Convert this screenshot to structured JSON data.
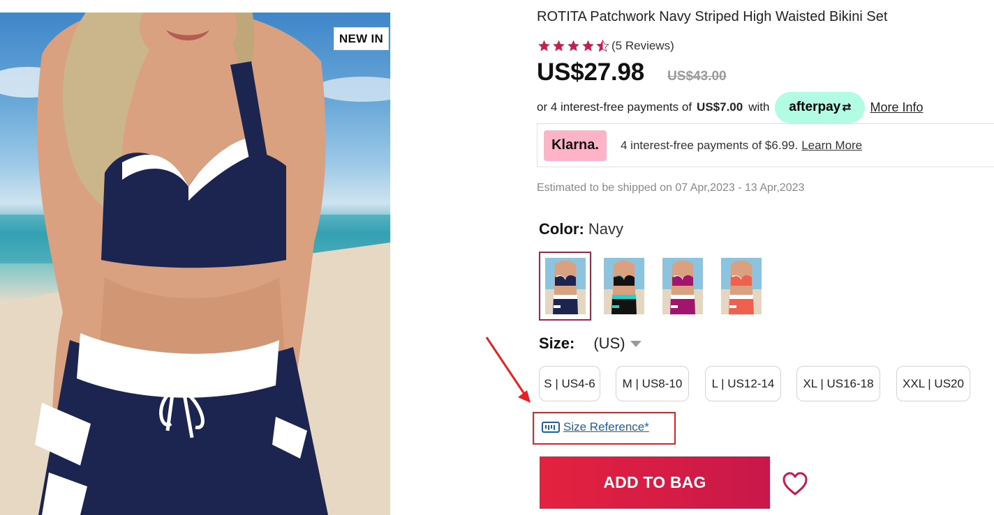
{
  "product": {
    "badge": "NEW IN",
    "title": "ROTITA Patchwork Navy Striped High Waisted Bikini Set",
    "rating": 4.5,
    "reviews": "(5 Reviews)",
    "price": "US$27.98",
    "old_price": "US$43.00"
  },
  "afterpay": {
    "prefix": "or 4 interest-free payments of",
    "amount": "US$7.00",
    "with": "with",
    "brand": "afterpay",
    "more_info": "More Info"
  },
  "klarna": {
    "brand": "Klarna.",
    "text": "4 interest-free payments of $6.99.",
    "learn_more": "Learn More"
  },
  "shipping": "Estimated to be shipped on 07 Apr,2023 - 13 Apr,2023",
  "color": {
    "label": "Color:",
    "value": "Navy",
    "swatches": [
      {
        "name": "navy",
        "top": "#1c2450",
        "accent": "#ffffff",
        "selected": true
      },
      {
        "name": "aqua",
        "top": "#121212",
        "accent": "#2ad1c4",
        "selected": false
      },
      {
        "name": "magenta",
        "top": "#a2146e",
        "accent": "#ffffff",
        "selected": false
      },
      {
        "name": "coral",
        "top": "#f0604f",
        "accent": "#ffffff",
        "selected": false
      }
    ],
    "selected_border": "#a5224b"
  },
  "size": {
    "label": "Size:",
    "unit": "(US)",
    "options": [
      "S | US4-6",
      "M | US8-10",
      "L | US12-14",
      "XL | US16-18",
      "XXL | US20"
    ],
    "reference": "Size Reference*"
  },
  "actions": {
    "add_to_bag": "ADD TO BAG"
  },
  "colors": {
    "brand_red": "#e4223f",
    "star": "#c71f4d",
    "afterpay_mint": "#b2fce4",
    "klarna_pink": "#ffb3c7",
    "annotation_red": "#e8211f",
    "link_blue": "#1a5fa8"
  }
}
